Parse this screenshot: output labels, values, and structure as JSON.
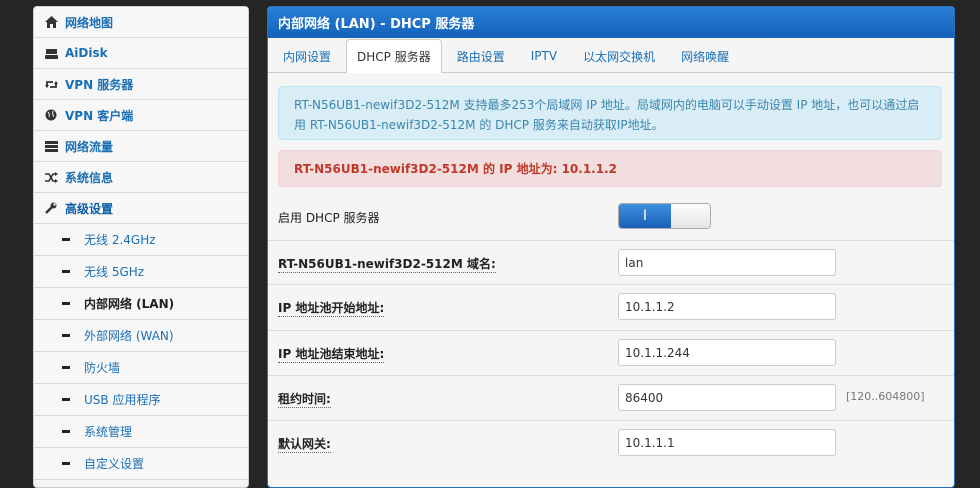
{
  "sidebar": {
    "items": [
      {
        "label": "网络地图",
        "icon": "home-icon"
      },
      {
        "label": "AiDisk",
        "icon": "hdd-icon"
      },
      {
        "label": "VPN 服务器",
        "icon": "retweet-icon"
      },
      {
        "label": "VPN 客户端",
        "icon": "globe-icon"
      },
      {
        "label": "网络流量",
        "icon": "tasks-icon"
      },
      {
        "label": "系统信息",
        "icon": "random-icon"
      },
      {
        "label": "高级设置",
        "icon": "wrench-icon"
      }
    ],
    "subitems": [
      {
        "label": "无线 2.4GHz"
      },
      {
        "label": "无线 5GHz"
      },
      {
        "label": "内部网络 (LAN)"
      },
      {
        "label": "外部网络 (WAN)"
      },
      {
        "label": "防火墙"
      },
      {
        "label": "USB 应用程序"
      },
      {
        "label": "系统管理"
      },
      {
        "label": "自定义设置"
      }
    ]
  },
  "main": {
    "title": "内部网络 (LAN) - DHCP 服务器",
    "tabs": [
      {
        "label": "内网设置"
      },
      {
        "label": "DHCP 服务器"
      },
      {
        "label": "路由设置"
      },
      {
        "label": "IPTV"
      },
      {
        "label": "以太网交换机"
      },
      {
        "label": "网络唤醒"
      }
    ],
    "active_tab": "DHCP 服务器",
    "info_text": "RT-N56UB1-newif3D2-512M 支持最多253个局域网 IP 地址。局域网内的电脑可以手动设置 IP 地址，也可以通过启用 RT-N56UB1-newif3D2-512M 的 DHCP 服务来自动获取IP地址。",
    "ip_notice": "RT-N56UB1-newif3D2-512M 的 IP 地址为: 10.1.1.2",
    "form": {
      "dhcp_enable_label": "启用 DHCP 服务器",
      "dhcp_enable_on_text": "I",
      "dhcp_enabled": true,
      "domain_label": "RT-N56UB1-newif3D2-512M 域名:",
      "domain_value": "lan",
      "pool_start_label": "IP 地址池开始地址:",
      "pool_start_value": "10.1.1.2",
      "pool_end_label": "IP 地址池结束地址:",
      "pool_end_value": "10.1.1.244",
      "lease_label": "租约时间:",
      "lease_value": "86400",
      "lease_hint": "[120..604800]",
      "gateway_label": "默认网关:",
      "gateway_value": "10.1.1.1"
    }
  },
  "colors": {
    "accent_blue": "#1a6fb5",
    "header_blue": "#1462b9",
    "info_bg": "#d9edf7",
    "error_bg": "#f2dede",
    "error_text": "#c0392b"
  }
}
